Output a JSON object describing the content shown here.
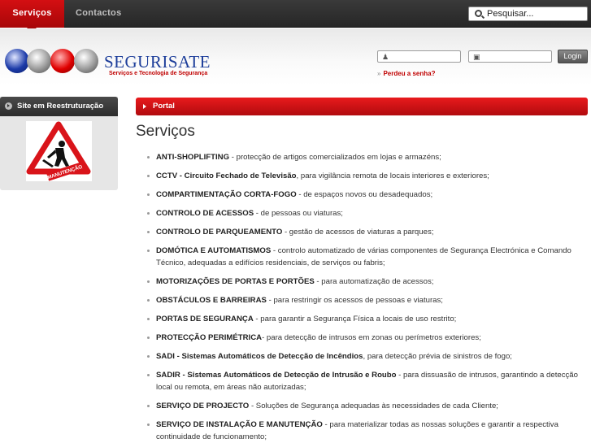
{
  "nav": {
    "tabs": [
      {
        "label": "Serviços",
        "active": true
      },
      {
        "label": "Contactos",
        "active": false
      }
    ],
    "search_placeholder": "Pesquisar..."
  },
  "header": {
    "brand": "SEGURISATE",
    "tagline": "Serviços e Tecnologia de Segurança",
    "login_button": "Login",
    "forgot_password": "Perdeu a senha?"
  },
  "sidebar": {
    "box_title": "Site em Reestruturação",
    "sign_text": "MANUTENÇÃO"
  },
  "main": {
    "breadcrumb": "Portal",
    "title": "Serviços",
    "services": [
      {
        "name": "ANTI-SHOPLIFTING",
        "desc": " - protecção de artigos comercializados em lojas e armazéns;"
      },
      {
        "name": "CCTV - Circuito Fechado de Televisão",
        "desc": ", para vigilância remota de locais interiores e exteriores;"
      },
      {
        "name": "COMPARTIMENTAÇÃO CORTA-FOGO",
        "desc": " - de espaços novos ou desadequados;"
      },
      {
        "name": "CONTROLO DE ACESSOS",
        "desc": " - de pessoas ou viaturas;"
      },
      {
        "name": "CONTROLO DE PARQUEAMENTO",
        "desc": " - gestão de acessos de viaturas a parques;"
      },
      {
        "name": "DOMÓTICA E AUTOMATISMOS",
        "desc": " - controlo automatizado de várias componentes de Segurança Electrónica e Comando Técnico, adequadas a edifícios residenciais, de serviços ou fabris;"
      },
      {
        "name": "MOTORIZAÇÕES DE PORTAS E PORTÕES",
        "desc": " - para automatização de acessos;"
      },
      {
        "name": "OBSTÁCULOS E BARREIRAS",
        "desc": " - para restringir os acessos de pessoas e viaturas;"
      },
      {
        "name": "PORTAS DE SEGURANÇA",
        "desc": " - para garantir a Segurança Física a locais de uso restrito;"
      },
      {
        "name": "PROTECÇÃO PERIMÉTRICA",
        "desc": "- para detecção de intrusos em zonas ou perímetros exteriores;"
      },
      {
        "name": "SADI - Sistemas Automáticos de Detecção de Incêndios",
        "desc": ", para detecção prévia de sinistros de fogo;"
      },
      {
        "name": "SADIR - Sistemas Automáticos de Detecção de Intrusão e Roubo",
        "desc": " - para dissuasão de intrusos, garantindo a detecção local ou remota, em áreas não autorizadas;"
      },
      {
        "name": "SERVIÇO DE PROJECTO",
        "desc": " - Soluções de Segurança adequadas às necessidades de cada Cliente;"
      },
      {
        "name": "SERVIÇO DE INSTALAÇÃO E MANUTENÇÃO",
        "desc": " - para materializar todas as nossas soluções e garantir a respectiva continuidade de funcionamento;"
      }
    ]
  },
  "colors": {
    "accent_red": "#d40f12",
    "brand_blue": "#1d3e9a",
    "nav_dark": "#2c2c2c"
  }
}
